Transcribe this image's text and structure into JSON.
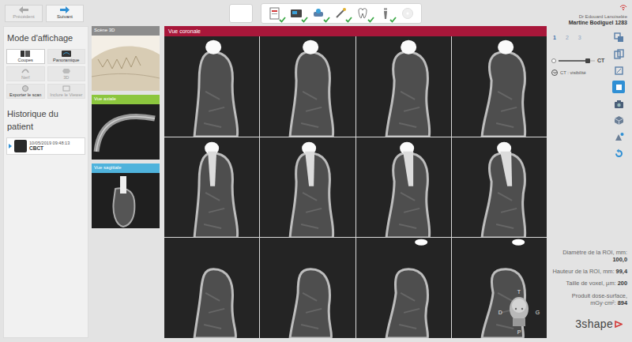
{
  "nav_buttons": [
    {
      "label": "Précédent",
      "disabled": true
    },
    {
      "label": "Suivant",
      "disabled": false
    }
  ],
  "workflow": [
    {
      "done": false,
      "disabled": false
    },
    {
      "done": true,
      "disabled": false
    },
    {
      "done": true,
      "disabled": false
    },
    {
      "done": true,
      "disabled": false
    },
    {
      "done": true,
      "disabled": false
    },
    {
      "done": true,
      "disabled": false
    },
    {
      "done": true,
      "disabled": false
    },
    {
      "done": false,
      "disabled": true
    }
  ],
  "user": {
    "doctor": "Dr Edouard Lanoiselée",
    "patient": "Martine Bodiguel 1283"
  },
  "display_mode": {
    "title": "Mode d'affichage",
    "modes": [
      {
        "label": "Coupes",
        "selected": true,
        "disabled": false
      },
      {
        "label": "Panoramique",
        "selected": false,
        "disabled": false
      },
      {
        "label": "Nerf",
        "selected": false,
        "disabled": true
      },
      {
        "label": "3D",
        "selected": false,
        "disabled": true
      }
    ],
    "actions": [
      {
        "label": "Exporter le scan",
        "disabled": false
      },
      {
        "label": "Inclure le Viewer",
        "disabled": true
      }
    ]
  },
  "history": {
    "title": "Historique du patient",
    "entries": [
      {
        "date": "10/05/2019 09:48:13",
        "type": "CBCT",
        "selected": true
      }
    ]
  },
  "thumbnails": [
    {
      "label": "Scène 3D",
      "color": "#8c8c8c"
    },
    {
      "label": "Vue axiale",
      "color": "#8cc63e"
    },
    {
      "label": "Vue sagittale",
      "color": "#4fb3dc"
    }
  ],
  "main_view": {
    "title": "Vue coronale",
    "slices": [
      {
        "kind": "crown"
      },
      {
        "kind": "crown"
      },
      {
        "kind": "crown"
      },
      {
        "kind": "crown"
      },
      {
        "kind": "implant"
      },
      {
        "kind": "implant"
      },
      {
        "kind": "implant"
      },
      {
        "kind": "implant"
      },
      {
        "kind": "base"
      },
      {
        "kind": "base"
      },
      {
        "kind": "base"
      },
      {
        "kind": "base"
      }
    ]
  },
  "orientation": {
    "top": "T",
    "left": "D",
    "right": "G",
    "bottom": "P"
  },
  "layers": {
    "tabs": [
      {
        "label": "1",
        "selected": true
      },
      {
        "label": "2",
        "selected": false
      },
      {
        "label": "3",
        "selected": false
      }
    ],
    "slider": {
      "label": "CT",
      "level": 0.8
    },
    "toggle": {
      "label": "CT : visibilité",
      "on": true
    }
  },
  "tools": [
    {
      "selected": false
    },
    {
      "selected": false
    },
    {
      "selected": false
    },
    {
      "selected": true
    },
    {
      "selected": false
    },
    {
      "selected": false
    },
    {
      "selected": false
    },
    {
      "selected": false
    }
  ],
  "stats": [
    {
      "label": "Diamètre de la ROI, mm:",
      "value": "100,0"
    },
    {
      "label": "Hauteur de la ROI, mm:",
      "value": "99,4"
    },
    {
      "label": "Taille de voxel, µm:",
      "value": "200"
    },
    {
      "label": "Produit dose-surface, mGy·cm²:",
      "value": "894"
    }
  ],
  "logo": {
    "text": "3shape"
  }
}
